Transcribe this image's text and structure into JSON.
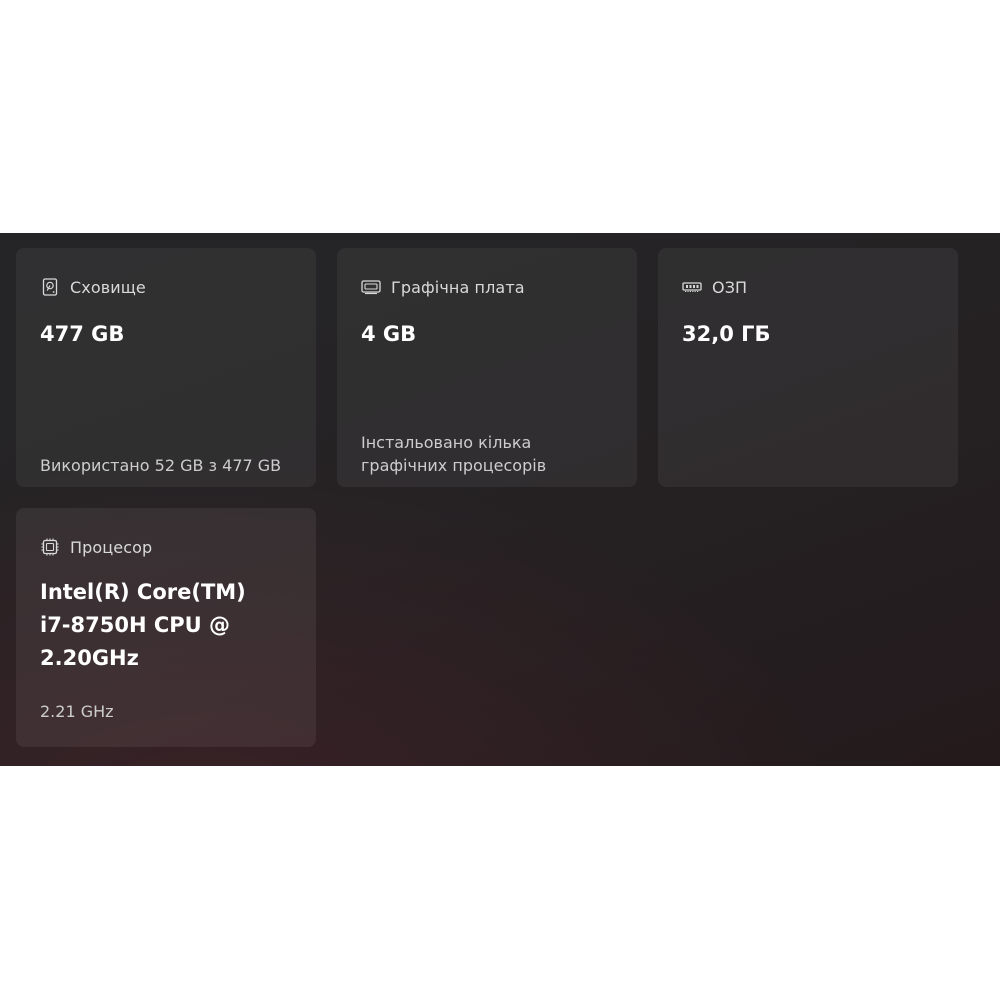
{
  "cards": {
    "storage": {
      "title": "Сховище",
      "icon": "hard-drive-icon",
      "value": "477 GB",
      "detail": "Використано 52 GB з 477 GB"
    },
    "gpu": {
      "title": "Графічна плата",
      "icon": "display-adapter-icon",
      "value": "4 GB",
      "detail": "Інстальовано кілька графічних процесорів"
    },
    "ram": {
      "title": "ОЗП",
      "icon": "memory-icon",
      "value": "32,0 ГБ"
    },
    "cpu": {
      "title": "Процесор",
      "icon": "processor-icon",
      "value_lines": [
        "Intel(R) Core(TM)",
        "i7-8750H CPU @",
        "2.20GHz"
      ],
      "detail": "2.21 GHz"
    }
  },
  "colors": {
    "panel_background": "#252325",
    "card_background": "#2f2d2f",
    "text_primary": "#ffffff",
    "text_secondary": "#cdcdcd"
  }
}
